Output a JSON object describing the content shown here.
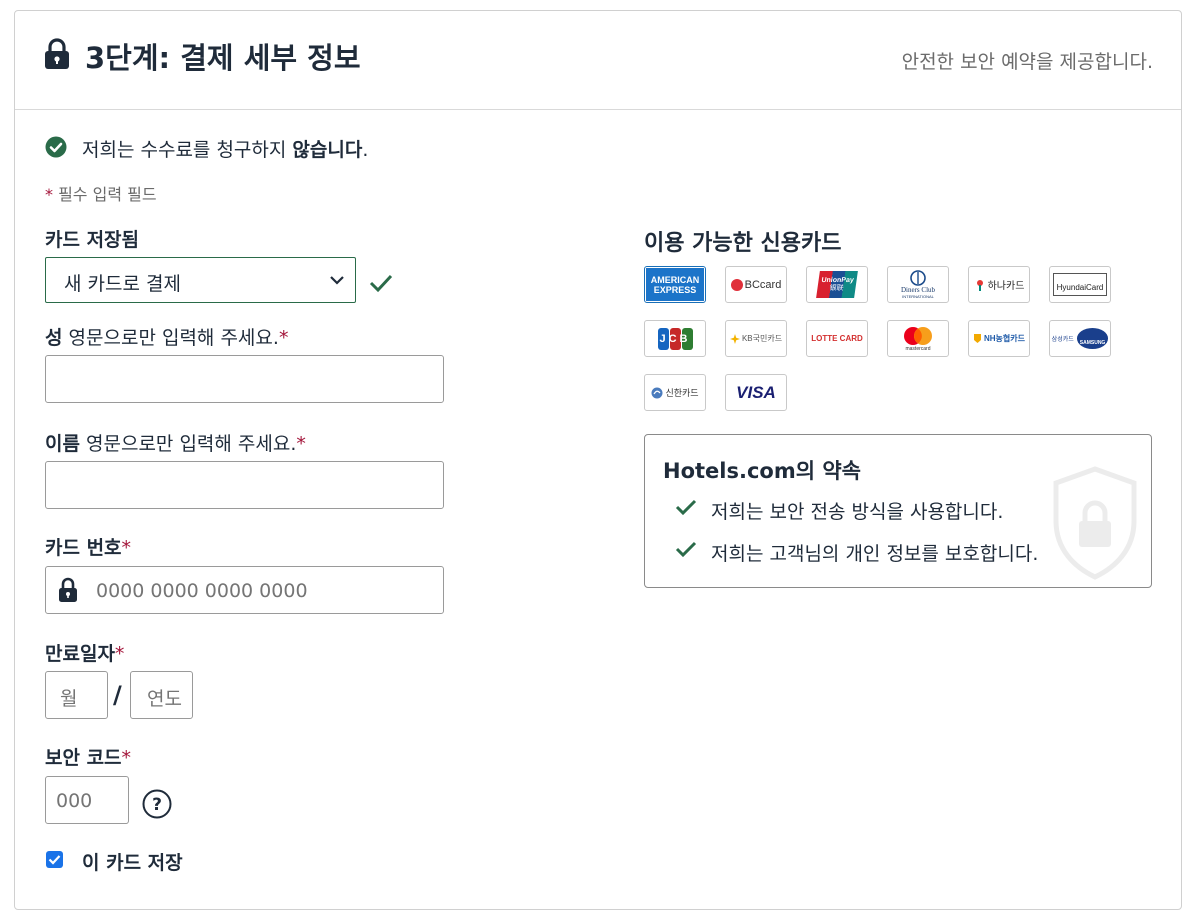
{
  "header": {
    "title": "3단계: 결제 세부 정보",
    "secure_note": "안전한 보안 예약을 제공합니다."
  },
  "fee_notice": {
    "prefix": "저희는 수수료를 청구하지 ",
    "bold": "않습니다",
    "suffix": "."
  },
  "required_note": {
    "star": "*",
    "text": " 필수 입력 필드"
  },
  "saved_card": {
    "label": "카드 저장됨",
    "selected": "새 카드로 결제"
  },
  "last_name": {
    "label_bold": "성",
    "label_rest": " 영문으로만 입력해 주세요.",
    "star": "*",
    "value": ""
  },
  "first_name": {
    "label_bold": "이름",
    "label_rest": " 영문으로만 입력해 주세요.",
    "star": "*",
    "value": ""
  },
  "card_number": {
    "label": "카드 번호",
    "star": "*",
    "placeholder": "0000 0000 0000 0000"
  },
  "expiry": {
    "label": "만료일자",
    "star": "*",
    "month_placeholder": "월",
    "slash": "/",
    "year_placeholder": "연도"
  },
  "security_code": {
    "label": "보안 코드",
    "star": "*",
    "placeholder": "000"
  },
  "save_card": {
    "label": "이 카드 저장",
    "checked": true
  },
  "available_cards": {
    "title": "이용 가능한 신용카드",
    "cards": [
      {
        "name": "AMERICAN EXPRESS",
        "line1": "AMERICAN",
        "line2": "EXPRESS"
      },
      {
        "name": "BCcard"
      },
      {
        "name": "UnionPay",
        "line1": "UnionPay",
        "line2": "银联"
      },
      {
        "name": "Diners Club",
        "line1": "Diners Club",
        "line2": "INTERNATIONAL"
      },
      {
        "name": "하나카드"
      },
      {
        "name": "HyundaiCard"
      },
      {
        "name": "JCB"
      },
      {
        "name": "KB국민카드"
      },
      {
        "name": "LOTTE CARD"
      },
      {
        "name": "mastercard"
      },
      {
        "name": "NH농협카드"
      },
      {
        "name": "삼성카드",
        "line2": "SAMSUNG"
      },
      {
        "name": "신한카드"
      },
      {
        "name": "VISA"
      }
    ]
  },
  "promise": {
    "title": "Hotels.com의 약속",
    "items": [
      "저희는 보안 전송 방식을 사용합니다.",
      "저희는 고객님의 개인 정보를 보호합니다."
    ]
  },
  "colors": {
    "brand_green": "#2a6b49",
    "required_star": "#a4163b",
    "checkbox_blue": "#1a73e8"
  }
}
